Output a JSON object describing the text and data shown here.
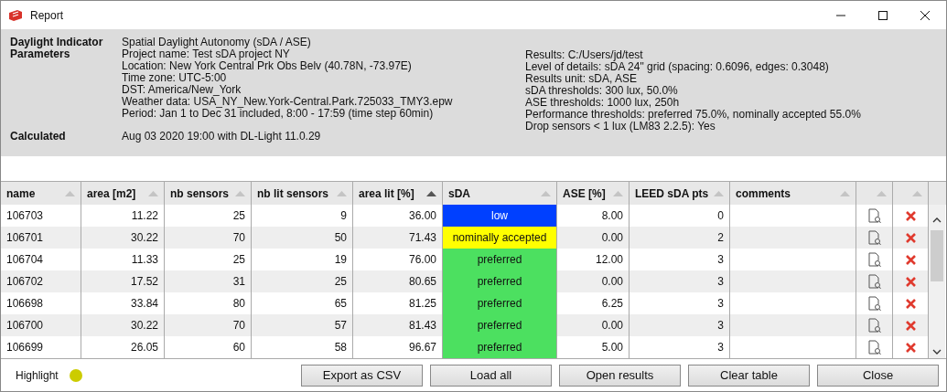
{
  "window": {
    "title": "Report"
  },
  "info": {
    "left": [
      {
        "label": "Daylight Indicator",
        "lines": [
          "Spatial Daylight Autonomy (sDA / ASE)"
        ]
      },
      {
        "label": "Parameters",
        "lines": [
          "Project name: Test sDA project NY",
          "Location: New York Central Prk Obs Belv (40.78N, -73.97E)",
          "Time zone: UTC-5:00",
          "DST: America/New_York",
          "Weather data: USA_NY_New.York-Central.Park.725033_TMY3.epw",
          "Period: Jan 1 to Dec 31 included, 8:00 - 17:59 (time step 60min)"
        ]
      },
      {
        "label": "Calculated",
        "lines": [
          "Aug 03 2020 19:00 with DL-Light 11.0.29"
        ]
      }
    ],
    "right": [
      "Results: C:/Users/jd/test",
      "Level of details: sDA 24\" grid (spacing: 0.6096, edges: 0.3048)",
      "Results unit: sDA, ASE",
      "sDA thresholds: 300 lux, 50.0%",
      "ASE thresholds: 1000 lux, 250h",
      "Performance thresholds: preferred 75.0%, nominally accepted 55.0%",
      "Drop sensors < 1 lux (LM83 2.2.5): Yes"
    ]
  },
  "table": {
    "columns": [
      {
        "label": "name",
        "sorted": false
      },
      {
        "label": "area [m2]",
        "sorted": false
      },
      {
        "label": "nb sensors",
        "sorted": false
      },
      {
        "label": "nb lit sensors",
        "sorted": false
      },
      {
        "label": "area lit [%]",
        "sorted": true
      },
      {
        "label": "sDA",
        "sorted": false
      },
      {
        "label": "ASE [%]",
        "sorted": false
      },
      {
        "label": "LEED sDA pts",
        "sorted": false
      },
      {
        "label": "comments",
        "sorted": false
      },
      {
        "sorted": false
      },
      {
        "sorted": false
      }
    ],
    "rows": [
      {
        "name": "106703",
        "area": "11.22",
        "sensors": "25",
        "lit": "9",
        "area_lit": "36.00",
        "sda": {
          "text": "low",
          "color": "#0040ff"
        },
        "ase": "8.00",
        "leed": "0"
      },
      {
        "name": "106701",
        "area": "30.22",
        "sensors": "70",
        "lit": "50",
        "area_lit": "71.43",
        "sda": {
          "text": "nominally accepted",
          "color": "#ffff00"
        },
        "ase": "0.00",
        "leed": "2"
      },
      {
        "name": "106704",
        "area": "11.33",
        "sensors": "25",
        "lit": "19",
        "area_lit": "76.00",
        "sda": {
          "text": "preferred",
          "color": "#4ce060"
        },
        "ase": "12.00",
        "leed": "3"
      },
      {
        "name": "106702",
        "area": "17.52",
        "sensors": "31",
        "lit": "25",
        "area_lit": "80.65",
        "sda": {
          "text": "preferred",
          "color": "#4ce060"
        },
        "ase": "0.00",
        "leed": "3"
      },
      {
        "name": "106698",
        "area": "33.84",
        "sensors": "80",
        "lit": "65",
        "area_lit": "81.25",
        "sda": {
          "text": "preferred",
          "color": "#4ce060"
        },
        "ase": "6.25",
        "leed": "3"
      },
      {
        "name": "106700",
        "area": "30.22",
        "sensors": "70",
        "lit": "57",
        "area_lit": "81.43",
        "sda": {
          "text": "preferred",
          "color": "#4ce060"
        },
        "ase": "0.00",
        "leed": "3"
      },
      {
        "name": "106699",
        "area": "26.05",
        "sensors": "60",
        "lit": "58",
        "area_lit": "96.67",
        "sda": {
          "text": "preferred",
          "color": "#4ce060"
        },
        "ase": "5.00",
        "leed": "3"
      }
    ]
  },
  "footer": {
    "highlight": {
      "label": "Highlight",
      "color": "#cccc00"
    },
    "buttons": [
      "Export as CSV",
      "Load all",
      "Open results",
      "Clear table",
      "Close"
    ]
  }
}
